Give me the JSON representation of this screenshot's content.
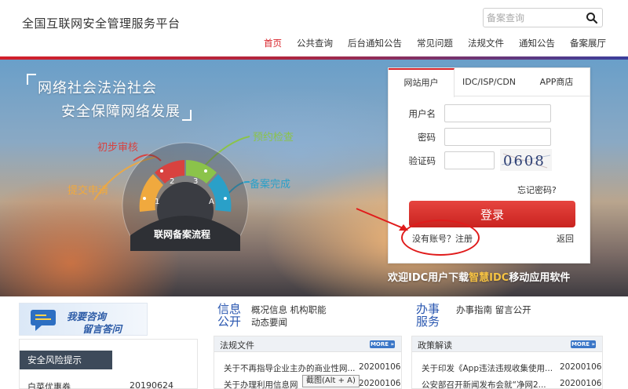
{
  "header": {
    "site_title": "全国互联网安全管理服务平台",
    "search_placeholder": "备案查询",
    "nav": [
      "首页",
      "公共查询",
      "后台通知公告",
      "常见问题",
      "法规文件",
      "通知公告",
      "备案展厅"
    ],
    "active_nav": "首页"
  },
  "banner": {
    "slogan_line1": "网络社会法治社会",
    "slogan_line2": "安全保障网络发展",
    "process": {
      "steps": [
        "提交申请",
        "初步审核",
        "预约检查",
        "备案完成"
      ],
      "segment_marks": [
        "1",
        "2",
        "3",
        "A"
      ],
      "title": "联网备案流程"
    },
    "promo_prefix": "欢迎IDC用户下载",
    "promo_highlight": "智慧IDC",
    "promo_suffix": "移动应用软件"
  },
  "login": {
    "tabs": [
      "网站用户",
      "IDC/ISP/CDN",
      "APP商店"
    ],
    "active_tab": "网站用户",
    "username_label": "用户名",
    "password_label": "密码",
    "captcha_label": "验证码",
    "captcha_text": "0608",
    "forgot": "忘记密码?",
    "submit": "登录",
    "register": "没有账号？注册",
    "back": "返回"
  },
  "consult": {
    "line1": "我要咨询",
    "line2": "留言答问"
  },
  "risk": {
    "title": "安全风险提示",
    "items": [
      {
        "name": "白菜优惠券",
        "date": "20190624"
      }
    ]
  },
  "info_section": {
    "title_line1": "信息",
    "title_line2": "公开",
    "links_row1": [
      "概况信息",
      "机构职能"
    ],
    "links_row2": [
      "动态要闻"
    ]
  },
  "work_section": {
    "title_line1": "办事",
    "title_line2": "服务",
    "links_row1": [
      "办事指南",
      "留言公开"
    ]
  },
  "laws_list": {
    "title": "法规文件",
    "more": "MORE »",
    "items": [
      {
        "title": "关于不再指导企业主办的商业性网...",
        "date": "20200106"
      },
      {
        "title": "关于办理利用信息网",
        "date": "20200106"
      }
    ]
  },
  "policy_list": {
    "title": "政策解读",
    "more": "MORE »",
    "items": [
      {
        "title": "关于印发《App违法违规收集使用...",
        "date": "20200106"
      },
      {
        "title": "公安部召开新闻发布会就“净网2...",
        "date": "20200106"
      }
    ]
  },
  "tooltip": "截图(Alt + A)",
  "colors": {
    "accent_red": "#d8232a",
    "link_blue": "#2a57b0",
    "risk_header": "#3d4a5a"
  }
}
